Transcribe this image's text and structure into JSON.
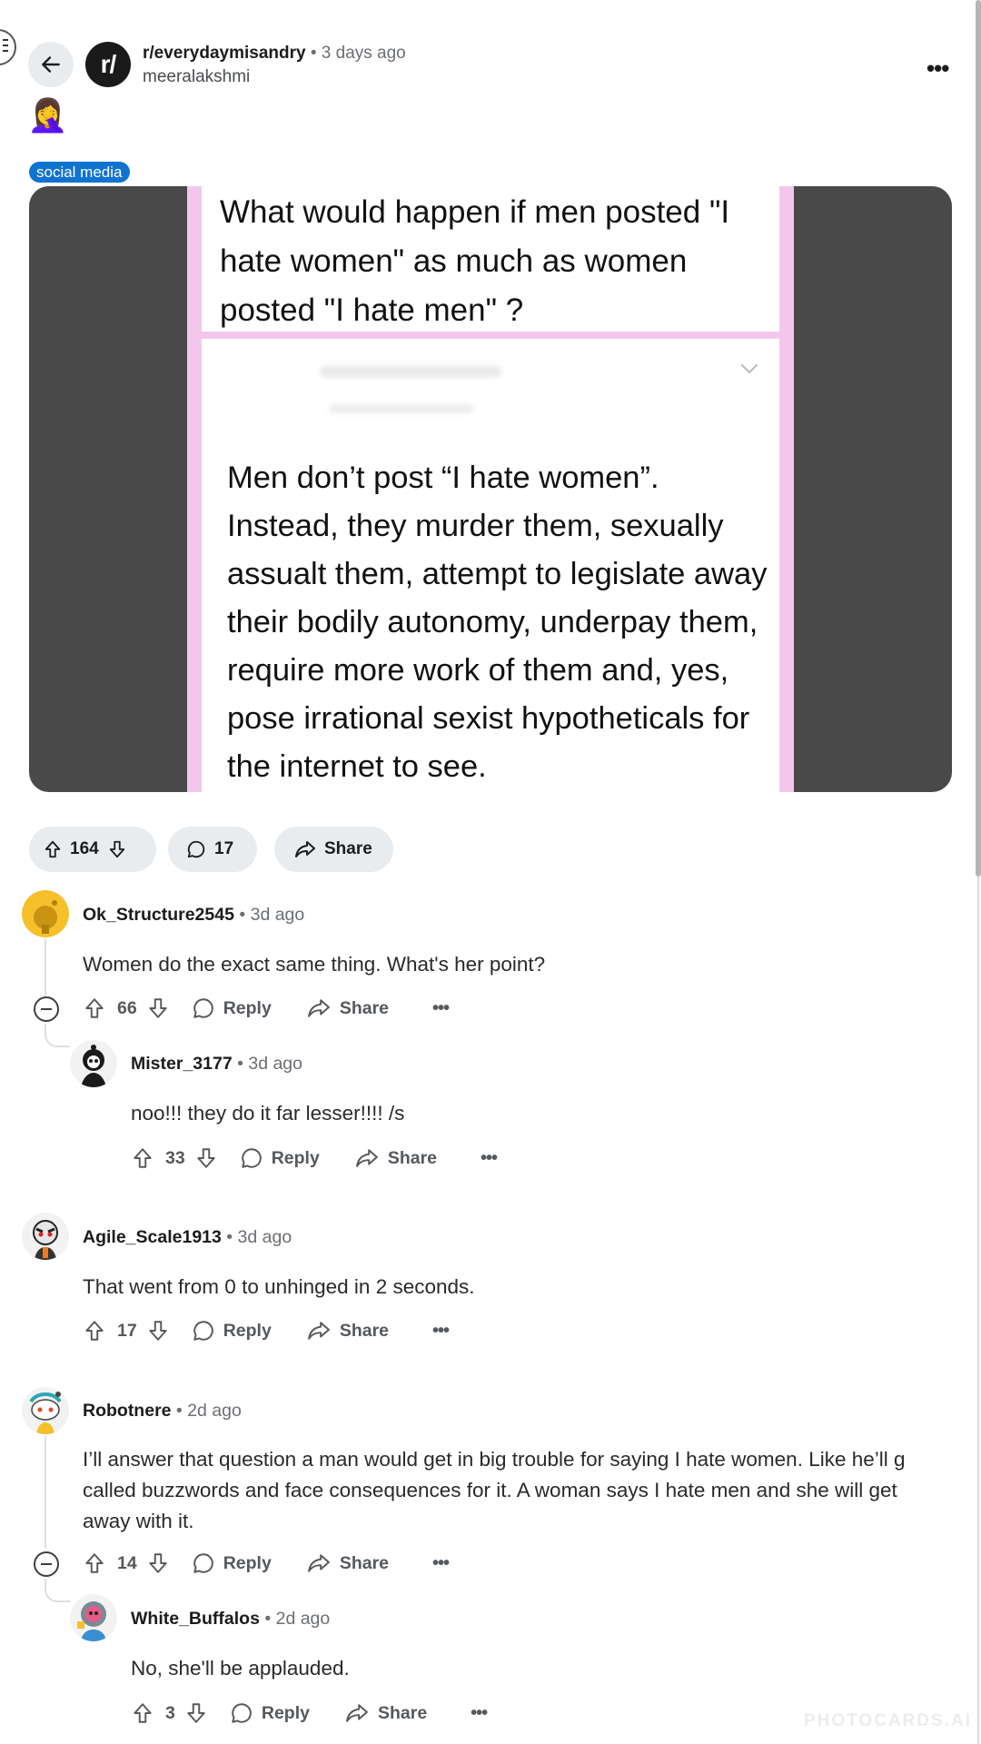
{
  "header": {
    "subreddit": "r/everydaymisandry",
    "separator": "•",
    "time": "3 days ago",
    "author": "meeralakshmi",
    "avatar_text": "r/",
    "more_label": "•••",
    "emoji": "🤦‍♀️"
  },
  "post": {
    "flair": "social media",
    "image": {
      "question": "What would happen if men posted \"I hate women\" as much as women posted \"I hate men\" ?",
      "answer": "Men don’t post “I hate women”. Instead, they murder them, sexually assualt them, attempt to legislate away their bodily autonomy, underpay them, require more work of them and, yes, pose irrational sexist hypotheticals for the internet to see."
    },
    "actions": {
      "votes": "164",
      "comments": "17",
      "share": "Share"
    }
  },
  "comments": [
    {
      "user": "Ok_Structure2545",
      "time": "3d ago",
      "body": "Women do the exact same thing. What's her point?",
      "score": "66",
      "reply": "Reply",
      "share": "Share",
      "more": "•••"
    },
    {
      "user": "Mister_3177",
      "time": "3d ago",
      "body": "noo!!! they do it far lesser!!!! /s",
      "score": "33",
      "reply": "Reply",
      "share": "Share",
      "more": "•••"
    },
    {
      "user": "Agile_Scale1913",
      "time": "3d ago",
      "body": "That went from 0 to unhinged in 2 seconds.",
      "score": "17",
      "reply": "Reply",
      "share": "Share",
      "more": "•••"
    },
    {
      "user": "Robotnere",
      "time": "2d ago",
      "body_lines": [
        "I’ll answer that question a man would get in big trouble for saying I hate women. Like he’ll g",
        "called buzzwords and face consequences for it. A woman says I hate men and she will get",
        "away with it."
      ],
      "score": "14",
      "reply": "Reply",
      "share": "Share",
      "more": "•••"
    },
    {
      "user": "White_Buffalos",
      "time": "2d ago",
      "body": "No, she'll be applauded.",
      "score": "3",
      "reply": "Reply",
      "share": "Share",
      "more": "•••"
    }
  ],
  "watermark": "PHOTOCARDS.AI",
  "colors": {
    "flair": "#0f73d0",
    "pill": "#e9ecef",
    "image_bg": "#494949",
    "image_border": "#f3c7ec"
  },
  "icons": [
    "back-arrow-icon",
    "upvote-icon",
    "downvote-icon",
    "comment-icon",
    "share-icon",
    "collapse-icon",
    "chevron-down-icon",
    "more-icon"
  ]
}
